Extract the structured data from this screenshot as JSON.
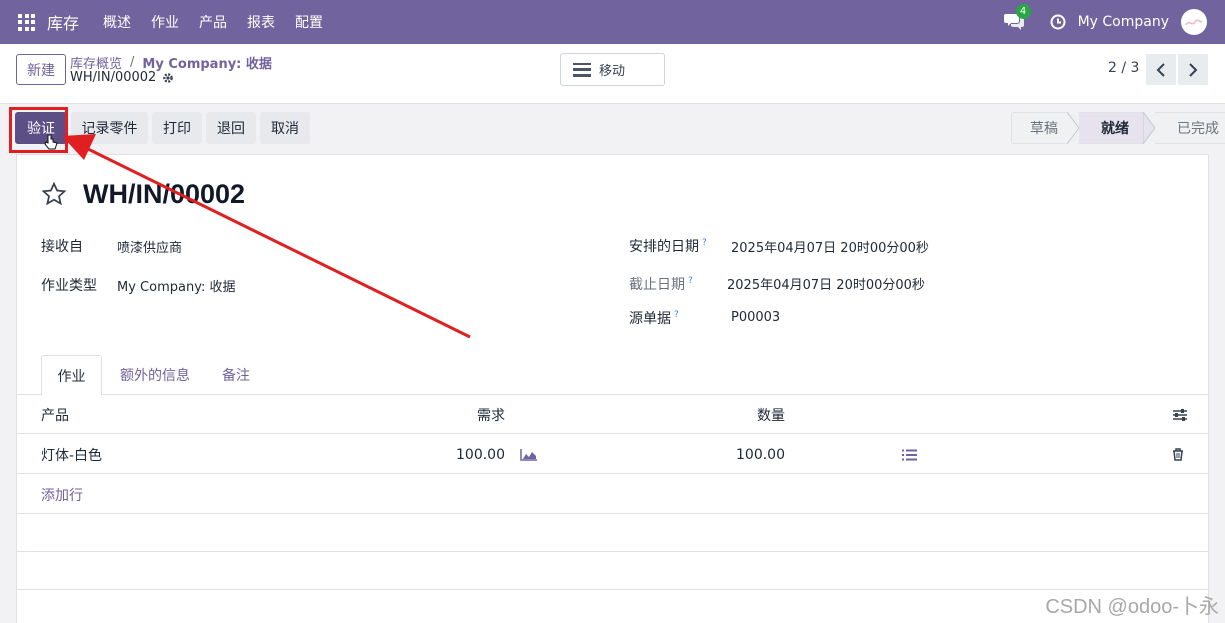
{
  "navbar": {
    "brand": "库存",
    "menu": [
      "概述",
      "作业",
      "产品",
      "报表",
      "配置"
    ],
    "chat_count": "4",
    "company": "My Company"
  },
  "control_panel": {
    "new_label": "新建",
    "breadcrumb_parent": "库存概览",
    "breadcrumb_current": "My Company: 收据",
    "record_name": "WH/IN/00002",
    "move_label": "移动",
    "pager": "2 / 3"
  },
  "actions": {
    "validate": "验证",
    "record_parts": "记录零件",
    "print": "打印",
    "return": "退回",
    "cancel": "取消"
  },
  "status": {
    "stages": [
      "草稿",
      "就绪",
      "已完成"
    ],
    "current": "就绪"
  },
  "form": {
    "title": "WH/IN/00002",
    "receive_from_label": "接收自",
    "receive_from": "喷漆供应商",
    "op_type_label": "作业类型",
    "op_type": "My Company: 收据",
    "scheduled_label": "安排的日期",
    "scheduled": "2025年04月07日 20时00分00秒",
    "deadline_label": "截止日期",
    "deadline": "2025年04月07日 20时00分00秒",
    "source_label": "源单据",
    "source": "P00003",
    "help_mark": "?"
  },
  "tabs": [
    "作业",
    "额外的信息",
    "备注"
  ],
  "table": {
    "headers": {
      "product": "产品",
      "demand": "需求",
      "quantity": "数量"
    },
    "rows": [
      {
        "product": "灯体-白色",
        "demand": "100.00",
        "quantity": "100.00"
      }
    ],
    "add_line": "添加行"
  },
  "colors": {
    "brand": "#71639e",
    "annotation": "#e02020"
  },
  "watermark": "CSDN @odoo-卜永"
}
